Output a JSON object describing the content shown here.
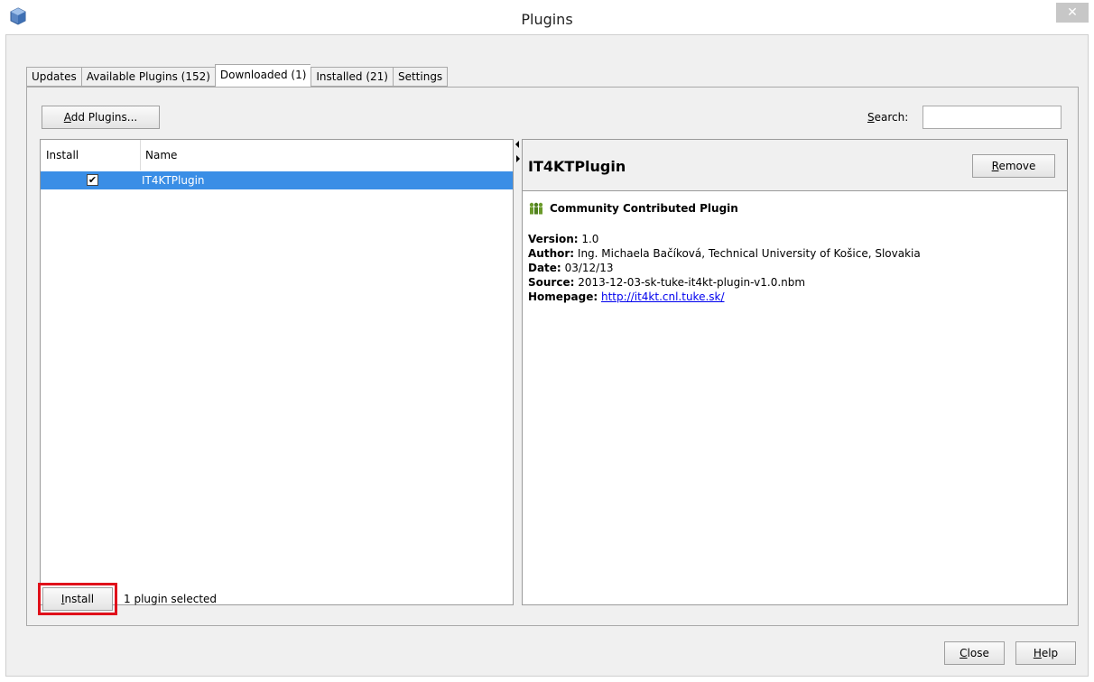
{
  "window": {
    "title": "Plugins",
    "close_glyph": "✕",
    "app_icon": "netbeans-cube-icon"
  },
  "tabs": [
    {
      "label": "Updates",
      "active": false
    },
    {
      "label": "Available Plugins (152)",
      "active": false
    },
    {
      "label": "Downloaded (1)",
      "active": true
    },
    {
      "label": "Installed (21)",
      "active": false
    },
    {
      "label": "Settings",
      "active": false
    }
  ],
  "toolbar": {
    "add_plugins_mnemonic": "A",
    "add_plugins_rest": "dd Plugins...",
    "search_mnemonic": "S",
    "search_rest": "earch:",
    "search_value": ""
  },
  "table": {
    "columns": [
      "Install",
      "Name"
    ],
    "rows": [
      {
        "checked": true,
        "check_glyph": "✔",
        "name": "IT4KTPlugin"
      }
    ]
  },
  "details": {
    "title": "IT4KTPlugin",
    "remove_mnemonic": "R",
    "remove_rest": "emove",
    "badge": "Community Contributed Plugin",
    "version_label": "Version:",
    "version": "1.0",
    "author_label": "Author:",
    "author": "Ing. Michaela Bačíková, Technical University of Košice, Slovakia",
    "date_label": "Date:",
    "date": "03/12/13",
    "source_label": "Source:",
    "source": "2013-12-03-sk-tuke-it4kt-plugin-v1.0.nbm",
    "homepage_label": "Homepage:",
    "homepage": "http://it4kt.cnl.tuke.sk/"
  },
  "footer": {
    "install_mnemonic": "I",
    "install_rest": "nstall",
    "status": "1 plugin selected",
    "close_mnemonic": "C",
    "close_rest": "lose",
    "help_mnemonic": "H",
    "help_rest": "elp"
  },
  "colors": {
    "selection": "#3a8ee6",
    "highlight": "#e0101a",
    "link": "#0000ee"
  }
}
